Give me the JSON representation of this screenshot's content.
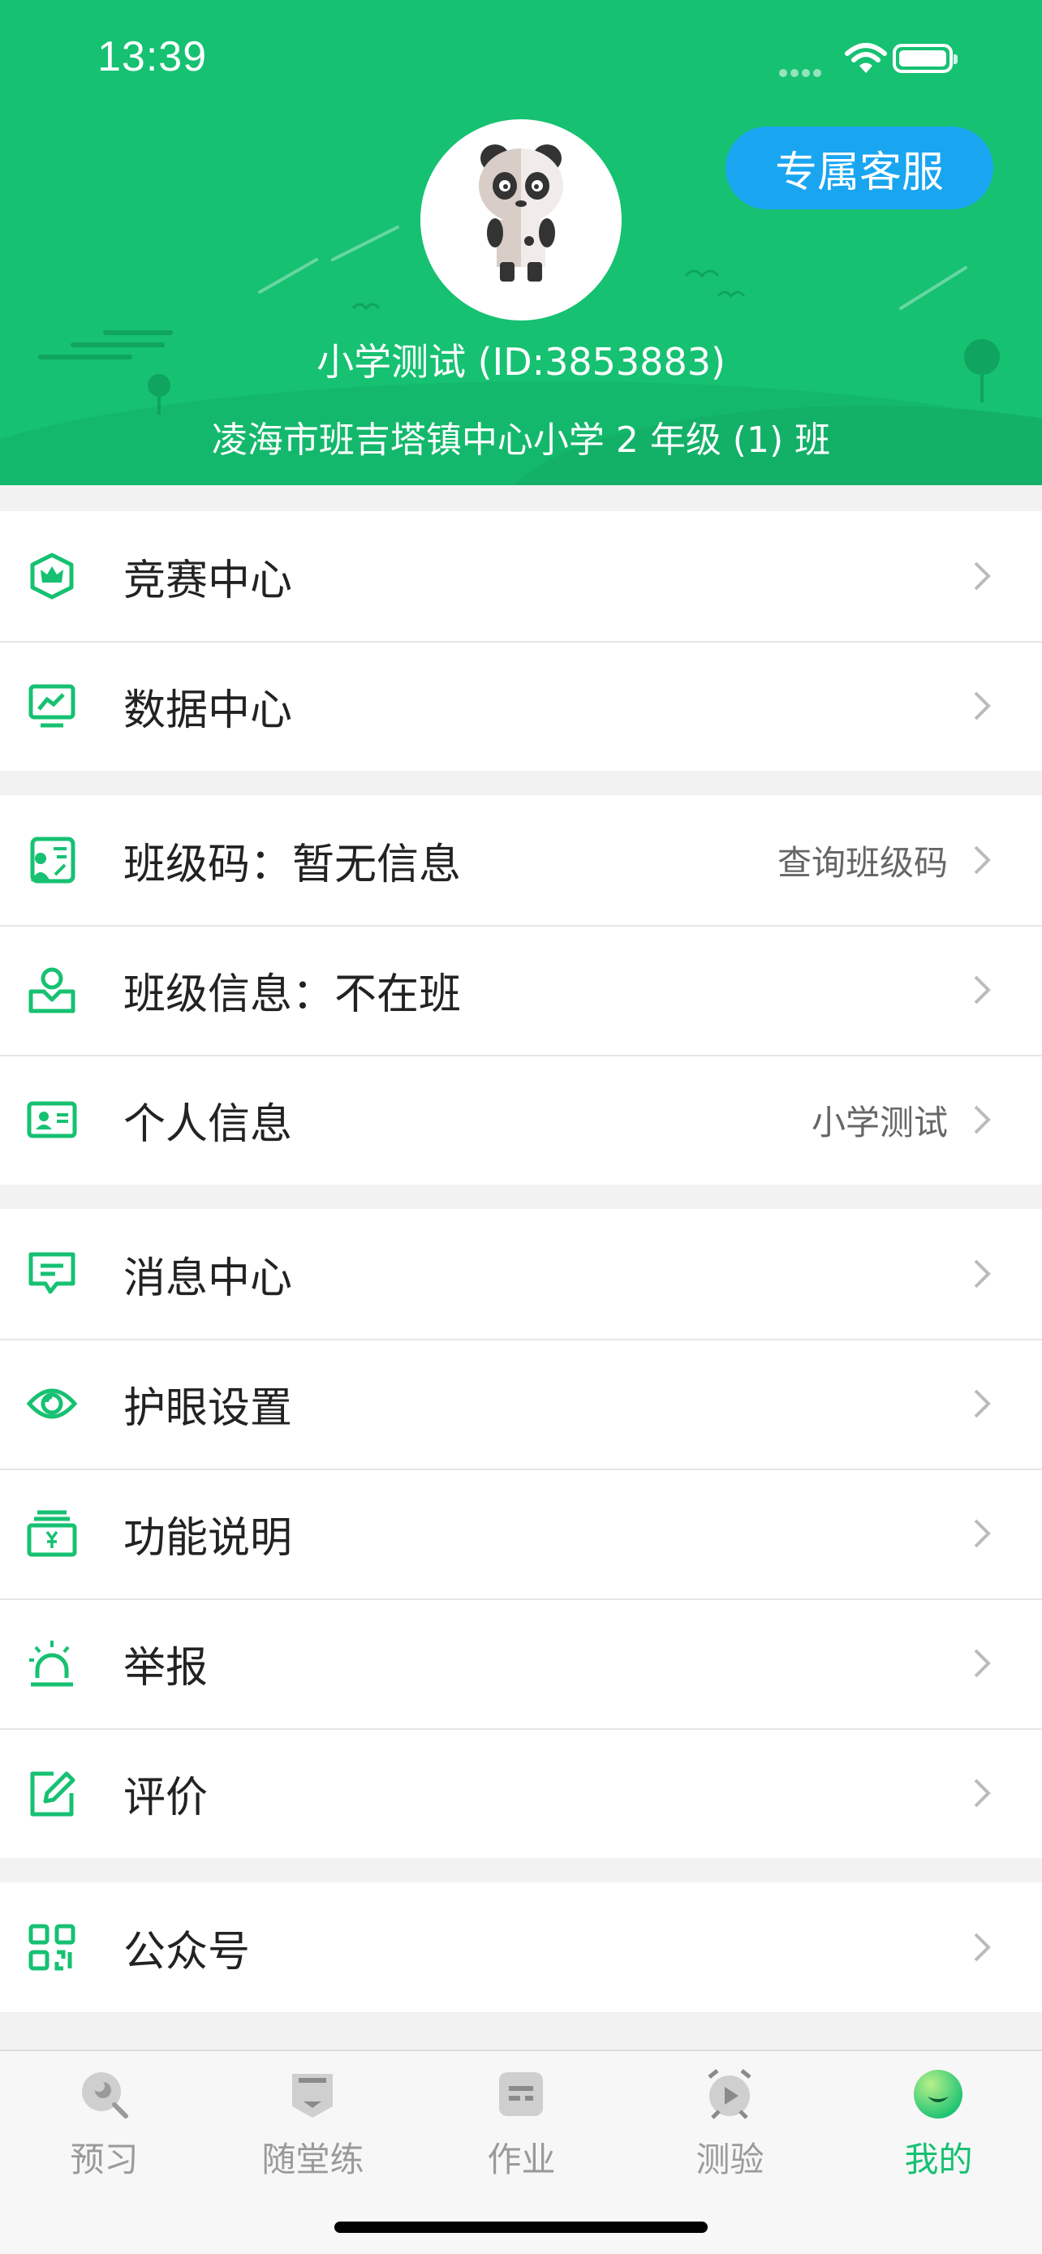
{
  "status_bar": {
    "time": "13:39"
  },
  "header": {
    "service_button": "专属客服",
    "user_name": "小学测试 (ID:3853883)",
    "school": "凌海市班吉塔镇中心小学 2 年级 (1) 班",
    "background_color": "#16c172",
    "service_color": "#1aa5f1"
  },
  "groups": [
    {
      "items": [
        {
          "icon": "crown-shield-icon",
          "label": "竞赛中心",
          "value": ""
        },
        {
          "icon": "monitor-chart-icon",
          "label": "数据中心",
          "value": ""
        }
      ]
    },
    {
      "items": [
        {
          "icon": "class-code-icon",
          "label": "班级码：暂无信息",
          "value": "查询班级码"
        },
        {
          "icon": "class-info-icon",
          "label": "班级信息：不在班",
          "value": ""
        },
        {
          "icon": "id-card-icon",
          "label": "个人信息",
          "value": "小学测试"
        }
      ]
    },
    {
      "items": [
        {
          "icon": "message-icon",
          "label": "消息中心",
          "value": ""
        },
        {
          "icon": "eye-icon",
          "label": "护眼设置",
          "value": ""
        },
        {
          "icon": "wallet-icon",
          "label": "功能说明",
          "value": ""
        },
        {
          "icon": "alarm-icon",
          "label": "举报",
          "value": ""
        },
        {
          "icon": "edit-icon",
          "label": "评价",
          "value": ""
        }
      ]
    },
    {
      "items": [
        {
          "icon": "qr-code-icon",
          "label": "公众号",
          "value": ""
        }
      ]
    }
  ],
  "tabs": [
    {
      "icon": "preview-icon",
      "label": "预习",
      "active": false
    },
    {
      "icon": "practice-icon",
      "label": "随堂练",
      "active": false
    },
    {
      "icon": "homework-icon",
      "label": "作业",
      "active": false
    },
    {
      "icon": "test-icon",
      "label": "测验",
      "active": false
    },
    {
      "icon": "mine-icon",
      "label": "我的",
      "active": true
    }
  ],
  "accent_color": "#16c172"
}
